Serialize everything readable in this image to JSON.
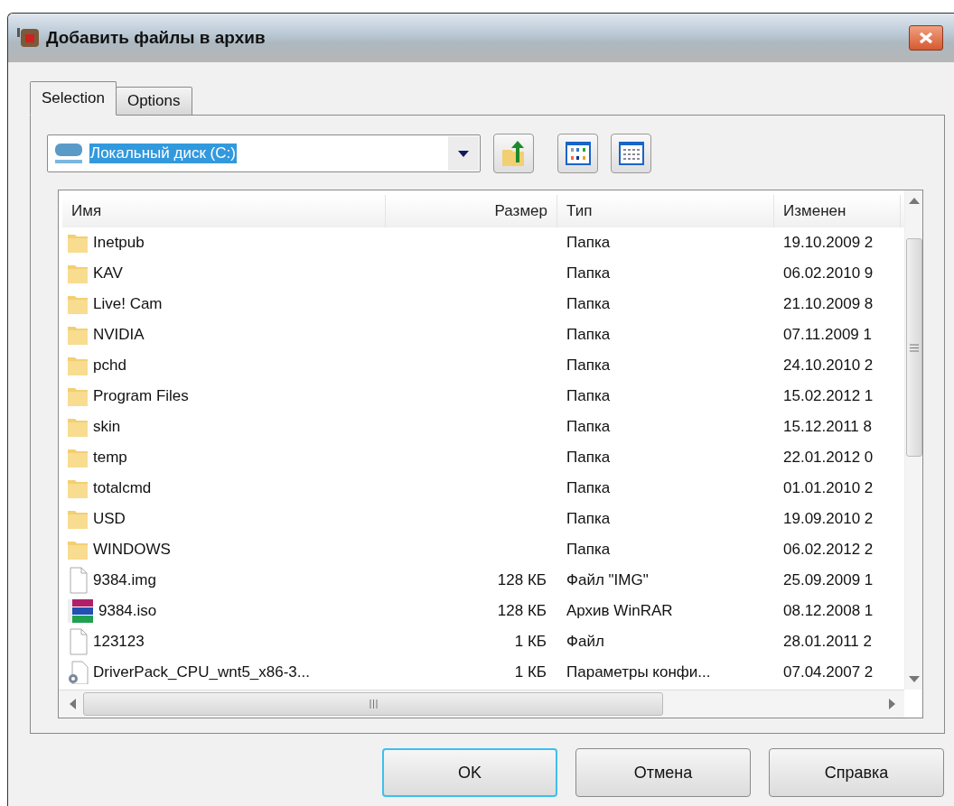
{
  "window": {
    "title": "Добавить файлы в архив"
  },
  "tabs": [
    {
      "label": "Selection",
      "selected": true
    },
    {
      "label": "Options",
      "selected": false
    }
  ],
  "location": {
    "value": "Локальный диск (C:)"
  },
  "table": {
    "columns": [
      "Имя",
      "Размер",
      "Тип",
      "Изменен"
    ],
    "rows": [
      {
        "kind": "folder",
        "name": "Inetpub",
        "size": "",
        "type": "Папка",
        "modified": "19.10.2009 2"
      },
      {
        "kind": "folder",
        "name": "KAV",
        "size": "",
        "type": "Папка",
        "modified": "06.02.2010 9"
      },
      {
        "kind": "folder",
        "name": "Live! Cam",
        "size": "",
        "type": "Папка",
        "modified": "21.10.2009 8"
      },
      {
        "kind": "folder",
        "name": "NVIDIA",
        "size": "",
        "type": "Папка",
        "modified": "07.11.2009 1"
      },
      {
        "kind": "folder",
        "name": "pchd",
        "size": "",
        "type": "Папка",
        "modified": "24.10.2010 2"
      },
      {
        "kind": "folder",
        "name": "Program Files",
        "size": "",
        "type": "Папка",
        "modified": "15.02.2012 1"
      },
      {
        "kind": "folder",
        "name": "skin",
        "size": "",
        "type": "Папка",
        "modified": "15.12.2011 8"
      },
      {
        "kind": "folder",
        "name": "temp",
        "size": "",
        "type": "Папка",
        "modified": "22.01.2012 0"
      },
      {
        "kind": "folder",
        "name": "totalcmd",
        "size": "",
        "type": "Папка",
        "modified": "01.01.2010 2"
      },
      {
        "kind": "folder",
        "name": "USD",
        "size": "",
        "type": "Папка",
        "modified": "19.09.2010 2"
      },
      {
        "kind": "folder",
        "name": "WINDOWS",
        "size": "",
        "type": "Папка",
        "modified": "06.02.2012 2"
      },
      {
        "kind": "file",
        "name": "9384.img",
        "size": "128 КБ",
        "type": "Файл \"IMG\"",
        "modified": "25.09.2009 1"
      },
      {
        "kind": "archive",
        "name": "9384.iso",
        "size": "128 КБ",
        "type": "Архив WinRAR",
        "modified": "08.12.2008 1"
      },
      {
        "kind": "file",
        "name": "123123",
        "size": "1 КБ",
        "type": "Файл",
        "modified": "28.01.2011 2"
      },
      {
        "kind": "config",
        "name": "DriverPack_CPU_wnt5_x86-3...",
        "size": "1 КБ",
        "type": "Параметры конфи...",
        "modified": "07.04.2007 2"
      }
    ]
  },
  "buttons": [
    {
      "label": "OK",
      "default": true
    },
    {
      "label": "Отмена",
      "default": false
    },
    {
      "label": "Справка",
      "default": false
    }
  ]
}
